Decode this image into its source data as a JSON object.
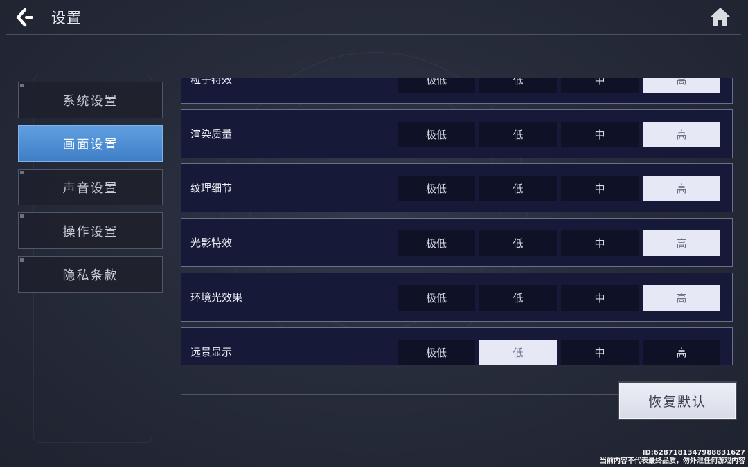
{
  "header": {
    "title": "设置",
    "back_icon": "back-arrow-icon",
    "home_icon": "home-icon"
  },
  "sidebar": {
    "items": [
      {
        "label": "系统设置",
        "active": false
      },
      {
        "label": "画面设置",
        "active": true
      },
      {
        "label": "声音设置",
        "active": false
      },
      {
        "label": "操作设置",
        "active": false
      },
      {
        "label": "隐私条款",
        "active": false
      }
    ]
  },
  "settings": {
    "rows": [
      {
        "label": "粒子特效",
        "options": [
          "极低",
          "低",
          "中",
          "高"
        ],
        "selected": "高"
      },
      {
        "label": "渲染质量",
        "options": [
          "极低",
          "低",
          "中",
          "高"
        ],
        "selected": "高"
      },
      {
        "label": "纹理细节",
        "options": [
          "极低",
          "低",
          "中",
          "高"
        ],
        "selected": "高"
      },
      {
        "label": "光影特效",
        "options": [
          "极低",
          "低",
          "中",
          "高"
        ],
        "selected": "高"
      },
      {
        "label": "环境光效果",
        "options": [
          "极低",
          "低",
          "中",
          "高"
        ],
        "selected": "高"
      },
      {
        "label": "远景显示",
        "options": [
          "极低",
          "低",
          "中",
          "高"
        ],
        "selected": "低"
      }
    ]
  },
  "reset_button": {
    "label": "恢复默认"
  },
  "watermark": {
    "id": "ID:6287181347988831627",
    "notice": "当前内容不代表最终品质，勿外泄任何游戏内容"
  },
  "colors": {
    "accent_blue": "#4f8fd6",
    "row_bg": "#171938",
    "option_bg": "#0f1126",
    "option_selected_bg": "#e6e8f6"
  }
}
